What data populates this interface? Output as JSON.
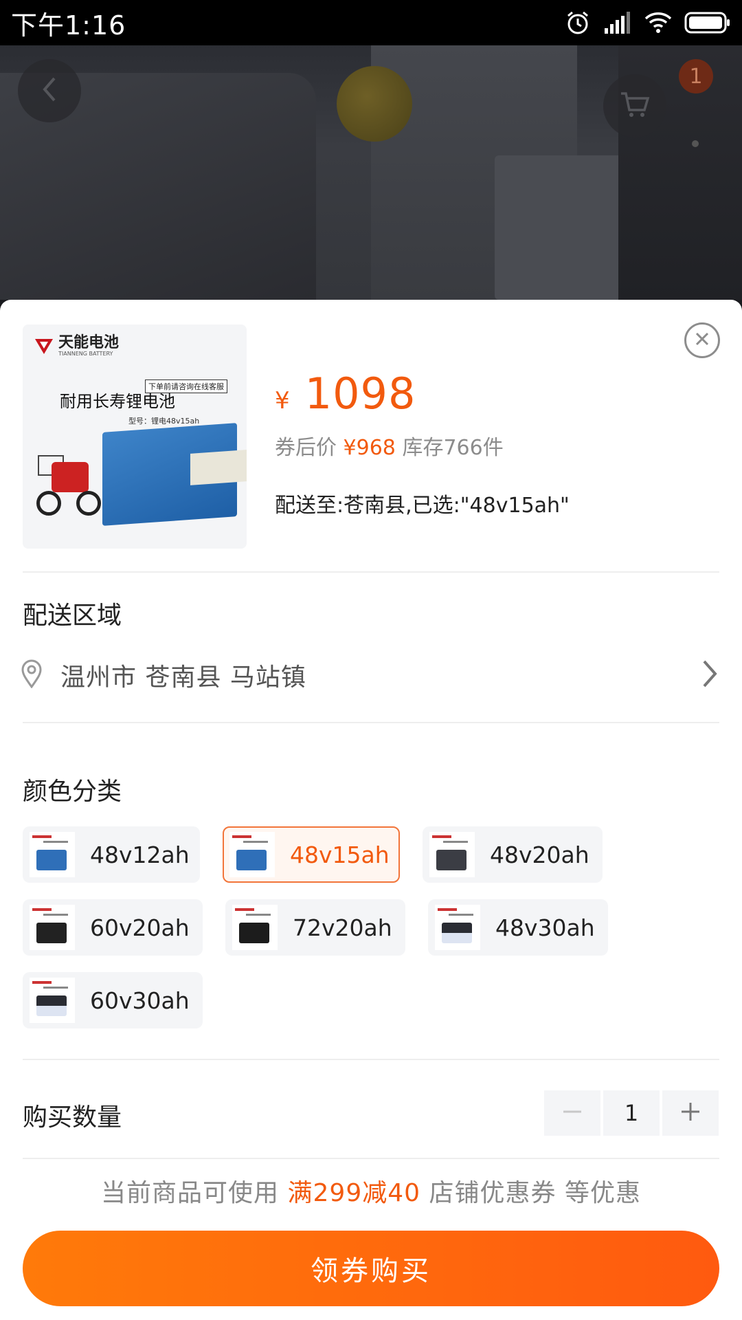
{
  "status_bar": {
    "time": "下午1:16",
    "icons": [
      "alarm-icon",
      "signal-icon",
      "wifi-icon",
      "battery-icon"
    ]
  },
  "header": {
    "cart_badge": "1",
    "icons": [
      "back-icon",
      "cart-icon"
    ]
  },
  "product": {
    "thumbnail": {
      "brand": "天能电池",
      "brand_sub": "TIANNENG BATTERY",
      "tag": "下单前请咨询在线客服",
      "title": "耐用长寿锂电池",
      "model": "型号：锂电48v15ah"
    },
    "currency": "¥",
    "price": "1098",
    "coupon_prefix": "券后价",
    "coupon_price": "¥968",
    "stock": "库存766件",
    "ship_line": "配送至:苍南县,已选:\"48v15ah\""
  },
  "delivery": {
    "title": "配送区域",
    "address": "温州市 苍南县 马站镇"
  },
  "variants": {
    "title": "颜色分类",
    "items": [
      {
        "label": "48v12ah",
        "selected": false
      },
      {
        "label": "48v15ah",
        "selected": true
      },
      {
        "label": "48v20ah",
        "selected": false
      },
      {
        "label": "60v20ah",
        "selected": false
      },
      {
        "label": "72v20ah",
        "selected": false
      },
      {
        "label": "48v30ah",
        "selected": false
      },
      {
        "label": "60v30ah",
        "selected": false
      }
    ]
  },
  "quantity": {
    "title": "购买数量",
    "value": "1",
    "minus": "−",
    "plus": "+"
  },
  "promo": {
    "prefix": "当前商品可使用",
    "highlight": "满299减40",
    "suffix": "店铺优惠券 等优惠"
  },
  "buy_button": "领券购买",
  "colors": {
    "accent": "#f25a0e",
    "button_start": "#ff7a0a",
    "button_end": "#ff5a0f",
    "selected_border": "#f2753a"
  }
}
